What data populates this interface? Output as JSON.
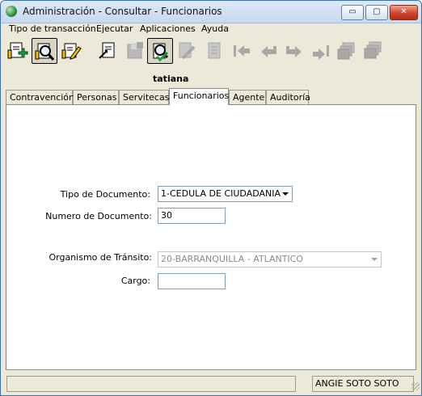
{
  "window": {
    "title": "Administración - Consultar - Funcionarios",
    "controls": {
      "minimize": "▭",
      "maximize": "▢",
      "close": "✕"
    }
  },
  "menu": {
    "items": [
      "Tipo de transacción",
      "Ejecutar",
      "Aplicaciones",
      "Ayuda"
    ]
  },
  "toolbar": {
    "buttons": [
      {
        "icon": "add-record-icon",
        "enabled": true
      },
      {
        "icon": "query-icon",
        "enabled": true,
        "pressed": true
      },
      {
        "icon": "edit-icon",
        "enabled": true
      },
      {
        "icon": "select-icon",
        "enabled": true
      },
      {
        "icon": "save-icon",
        "enabled": false
      },
      {
        "icon": "execute-query-icon",
        "enabled": true,
        "pressed": true
      },
      {
        "icon": "cancel-icon",
        "enabled": false
      },
      {
        "icon": "document-icon",
        "enabled": false
      },
      {
        "icon": "first-record-icon",
        "enabled": false
      },
      {
        "icon": "previous-record-icon",
        "enabled": false
      },
      {
        "icon": "next-record-icon",
        "enabled": false
      },
      {
        "icon": "last-record-icon",
        "enabled": false
      },
      {
        "icon": "stack-icon",
        "enabled": false
      },
      {
        "icon": "stack-alt-icon",
        "enabled": false
      }
    ]
  },
  "record_user": "tatiana",
  "tabs": [
    {
      "label": "Contravención",
      "active": false
    },
    {
      "label": "Personas",
      "active": false
    },
    {
      "label": "Servitecas",
      "active": false
    },
    {
      "label": "Funcionarios",
      "active": true
    },
    {
      "label": "Agente",
      "active": false
    },
    {
      "label": "Auditoría",
      "active": false
    }
  ],
  "form": {
    "tipo_documento": {
      "label": "Tipo de Documento:",
      "value": "1-CEDULA DE CIUDADANIA"
    },
    "numero_documento": {
      "label": "Numero de Documento:",
      "value": "30"
    },
    "organismo": {
      "label": "Organismo de Tránsito:",
      "value": "20-BARRANQUILLA - ATLANTICO"
    },
    "cargo": {
      "label": "Cargo:",
      "value": ""
    }
  },
  "status": {
    "message": "",
    "user": "ANGIE  SOTO SOTO"
  },
  "colors": {
    "title_gradient": [
      "#dde9f7",
      "#c6d9ef"
    ],
    "close_button": "#d1442a",
    "window_bg": "#ece9d8",
    "icon_yellow": "#f2c400",
    "icon_green": "#1f9a3a",
    "icon_disabled": "#a8a8a8"
  }
}
